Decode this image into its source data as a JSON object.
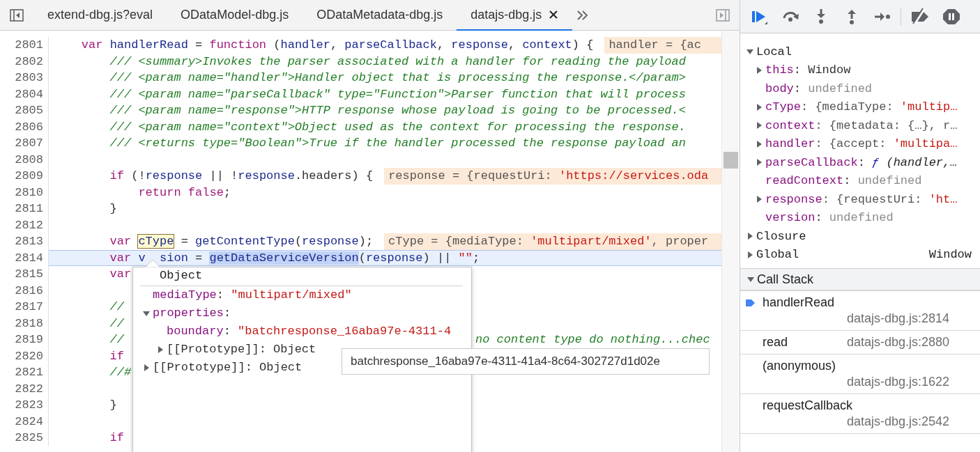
{
  "tabs": [
    {
      "label": "extend-dbg.js?eval",
      "selected": false
    },
    {
      "label": "ODataModel-dbg.js",
      "selected": false
    },
    {
      "label": "ODataMetadata-dbg.js",
      "selected": false
    },
    {
      "label": "datajs-dbg.js",
      "selected": true
    }
  ],
  "lines": [
    {
      "number": "2801",
      "current": false,
      "tokens": [
        {
          "text": "    var ",
          "kind": "keyword"
        },
        {
          "text": "handlerRead",
          "kind": "identifier"
        },
        {
          "text": " = ",
          "kind": "plain"
        },
        {
          "text": "function",
          "kind": "keyword"
        },
        {
          "text": " (",
          "kind": "plain"
        },
        {
          "text": "handler",
          "kind": "identifier"
        },
        {
          "text": ", ",
          "kind": "plain"
        },
        {
          "text": "parseCallback",
          "kind": "identifier"
        },
        {
          "text": ", ",
          "kind": "plain"
        },
        {
          "text": "response",
          "kind": "identifier"
        },
        {
          "text": ", ",
          "kind": "plain"
        },
        {
          "text": "context",
          "kind": "identifier"
        },
        {
          "text": ") {",
          "kind": "plain"
        }
      ],
      "inline_value": [
        {
          "text": "handler = {ac",
          "kind": "plain"
        }
      ]
    },
    {
      "number": "2802",
      "current": false,
      "tokens": [
        {
          "text": "        /// <summary>Invokes the parser associated with a handler for reading the payload",
          "kind": "comment"
        }
      ]
    },
    {
      "number": "2803",
      "current": false,
      "tokens": [
        {
          "text": "        /// <param name=\"handler\">Handler object that is processing the response.</param>",
          "kind": "comment"
        }
      ]
    },
    {
      "number": "2804",
      "current": false,
      "tokens": [
        {
          "text": "        /// <param name=\"parseCallback\" type=\"Function\">Parser function that will process",
          "kind": "comment"
        }
      ]
    },
    {
      "number": "2805",
      "current": false,
      "tokens": [
        {
          "text": "        /// <param name=\"response\">HTTP response whose payload is going to be processed.<",
          "kind": "comment"
        }
      ]
    },
    {
      "number": "2806",
      "current": false,
      "tokens": [
        {
          "text": "        /// <param name=\"context\">Object used as the context for processing the response.",
          "kind": "comment"
        }
      ]
    },
    {
      "number": "2807",
      "current": false,
      "tokens": [
        {
          "text": "        /// <returns type=\"Boolean\">True if the handler processed the response payload an",
          "kind": "comment"
        }
      ]
    },
    {
      "number": "2808",
      "current": false
    },
    {
      "number": "2809",
      "current": false,
      "tokens": [
        {
          "text": "        if",
          "kind": "keyword"
        },
        {
          "text": " (!",
          "kind": "plain"
        },
        {
          "text": "response",
          "kind": "identifier"
        },
        {
          "text": " || !",
          "kind": "plain"
        },
        {
          "text": "response",
          "kind": "identifier"
        },
        {
          "text": ".headers) {",
          "kind": "plain"
        }
      ],
      "inline_value": [
        {
          "text": "response = {requestUri: ",
          "kind": "plain"
        },
        {
          "text": "'https://services.oda",
          "kind": "string"
        }
      ]
    },
    {
      "number": "2810",
      "current": false,
      "tokens": [
        {
          "text": "            return false",
          "kind": "keyword"
        },
        {
          "text": ";",
          "kind": "plain"
        }
      ]
    },
    {
      "number": "2811",
      "current": false,
      "tokens": [
        {
          "text": "        }",
          "kind": "plain"
        }
      ]
    },
    {
      "number": "2812",
      "current": false
    },
    {
      "number": "2813",
      "current": false,
      "tokens": [
        {
          "text": "        var ",
          "kind": "keyword"
        },
        {
          "text": "cType",
          "kind": "hover"
        },
        {
          "text": " = ",
          "kind": "plain"
        },
        {
          "text": "getContentType",
          "kind": "identifier"
        },
        {
          "text": "(",
          "kind": "plain"
        },
        {
          "text": "response",
          "kind": "identifier"
        },
        {
          "text": ");",
          "kind": "plain"
        }
      ],
      "inline_value": [
        {
          "text": "cType = {mediaType: ",
          "kind": "plain"
        },
        {
          "text": "'multipart/mixed'",
          "kind": "string"
        },
        {
          "text": ", proper",
          "kind": "plain"
        }
      ]
    },
    {
      "number": "2814",
      "current": true,
      "tokens": [
        {
          "text": "        var",
          "kind": "keyword"
        },
        {
          "text": " v",
          "kind": "identifier"
        },
        {
          "text": "  sion",
          "kind": "identifier"
        },
        {
          "text": " = ",
          "kind": "plain"
        },
        {
          "text": "getDataServiceVersion",
          "kind": "selection"
        },
        {
          "text": "(",
          "kind": "plain"
        },
        {
          "text": "response",
          "kind": "identifier"
        },
        {
          "text": ") || ",
          "kind": "plain"
        },
        {
          "text": "\"\"",
          "kind": "string"
        },
        {
          "text": ";",
          "kind": "plain"
        }
      ]
    },
    {
      "number": "2815",
      "current": false,
      "tokens": [
        {
          "text": "        var",
          "kind": "keyword"
        }
      ]
    },
    {
      "number": "2816",
      "current": false
    },
    {
      "number": "2817",
      "current": false,
      "tokens": [
        {
          "text": "        //",
          "kind": "comment"
        }
      ]
    },
    {
      "number": "2818",
      "current": false,
      "tokens": [
        {
          "text": "        //",
          "kind": "comment"
        }
      ]
    },
    {
      "number": "2819",
      "current": false,
      "tokens": [
        {
          "text": "        //",
          "kind": "comment"
        }
      ],
      "tail": "no content type do nothing...chec"
    },
    {
      "number": "2820",
      "current": false,
      "tokens": [
        {
          "text": "        if",
          "kind": "keyword"
        }
      ]
    },
    {
      "number": "2821",
      "current": false,
      "tokens": [
        {
          "text": "        //#",
          "kind": "comment"
        }
      ]
    },
    {
      "number": "2822",
      "current": false
    },
    {
      "number": "2823",
      "current": false,
      "tokens": [
        {
          "text": "        }",
          "kind": "plain"
        }
      ]
    },
    {
      "number": "2824",
      "current": false
    },
    {
      "number": "2825",
      "current": false,
      "tokens": [
        {
          "text": "        if",
          "kind": "keyword"
        }
      ]
    }
  ],
  "popover": {
    "title": "Object",
    "properties": [
      {
        "name": "mediaType",
        "kind": "primitive",
        "value": [
          {
            "text": ": ",
            "kind": "plain"
          },
          {
            "text": "\"multipart/mixed\"",
            "kind": "string"
          }
        ]
      },
      {
        "name": "properties",
        "kind": "object",
        "value": [
          {
            "text": ":",
            "kind": "plain"
          }
        ],
        "children": [
          {
            "name": "boundary",
            "kind": "primitive",
            "value": [
              {
                "text": ": ",
                "kind": "plain"
              },
              {
                "text": "\"batchresponse_16aba97e-4311-4",
                "kind": "string"
              }
            ]
          },
          {
            "name": "[[Prototype]]",
            "kind": "internal",
            "value": [
              {
                "text": ": Object",
                "kind": "plain"
              }
            ]
          }
        ]
      },
      {
        "name": "[[Prototype]]",
        "kind": "internal",
        "value": [
          {
            "text": ": Object",
            "kind": "plain"
          }
        ]
      }
    ]
  },
  "tooltip": "batchresponse_16aba97e-4311-41a4-8c64-302727d1d02e",
  "scope": {
    "sections": [
      {
        "title": "Local",
        "expanded": true,
        "variables": [
          {
            "name": "this",
            "kind": "object",
            "value": [
              {
                "text": ": Window",
                "kind": "plain"
              }
            ]
          },
          {
            "name": "body",
            "kind": "primitive",
            "value": [
              {
                "text": ": ",
                "kind": "plain"
              },
              {
                "text": "undefined",
                "kind": "undefined"
              }
            ]
          },
          {
            "name": "cType",
            "kind": "object",
            "value": [
              {
                "text": ": {mediaType: ",
                "kind": "preview"
              },
              {
                "text": "'multip…",
                "kind": "string"
              }
            ]
          },
          {
            "name": "context",
            "kind": "object",
            "value": [
              {
                "text": ": {metadata: {…}, r…",
                "kind": "preview"
              }
            ]
          },
          {
            "name": "handler",
            "kind": "object",
            "value": [
              {
                "text": ": {accept: ",
                "kind": "preview"
              },
              {
                "text": "'multipa…",
                "kind": "string"
              }
            ]
          },
          {
            "name": "parseCallback",
            "kind": "object",
            "value": [
              {
                "text": ": ",
                "kind": "plain"
              },
              {
                "text": "ƒ",
                "kind": "function"
              },
              {
                "text": " (handler,…",
                "kind": "italic"
              }
            ]
          },
          {
            "name": "readContext",
            "kind": "primitive",
            "value": [
              {
                "text": ": ",
                "kind": "plain"
              },
              {
                "text": "undefined",
                "kind": "undefined"
              }
            ]
          },
          {
            "name": "response",
            "kind": "object",
            "value": [
              {
                "text": ": {requestUri: ",
                "kind": "preview"
              },
              {
                "text": "'ht…",
                "kind": "string"
              }
            ]
          },
          {
            "name": "version",
            "kind": "primitive",
            "value": [
              {
                "text": ": ",
                "kind": "plain"
              },
              {
                "text": "undefined",
                "kind": "undefined"
              }
            ]
          }
        ]
      },
      {
        "title": "Closure",
        "expanded": false
      },
      {
        "title": "Global",
        "expanded": false,
        "value": "Window"
      }
    ]
  },
  "call_stack": {
    "title": "Call Stack",
    "expanded": true,
    "frames": [
      {
        "name": "handlerRead",
        "location": "datajs-dbg.js:2814",
        "selected": true
      },
      {
        "name": "read",
        "location": "datajs-dbg.js:2880",
        "selected": false
      },
      {
        "name": "(anonymous)",
        "location": "datajs-dbg.js:1622",
        "selected": false
      },
      {
        "name": "requestCallback",
        "location": "datajs-dbg.js:2542",
        "selected": false
      }
    ]
  }
}
